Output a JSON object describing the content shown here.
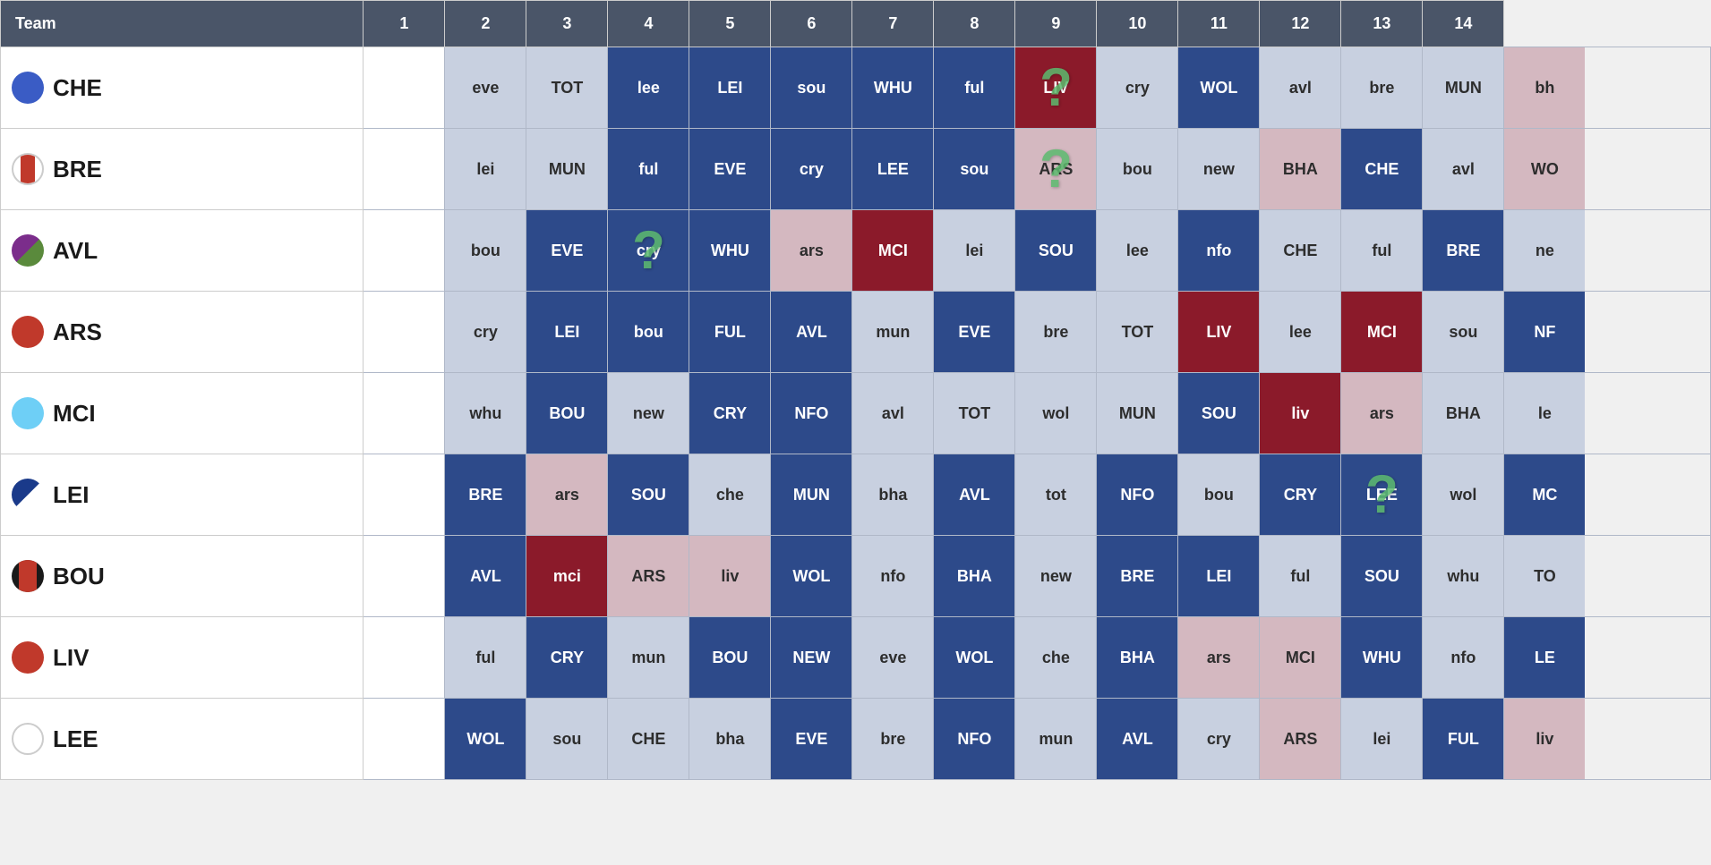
{
  "header": {
    "team_label": "Team",
    "columns": [
      "1",
      "2",
      "3",
      "4",
      "5",
      "6",
      "7",
      "8",
      "9",
      "10",
      "11",
      "12",
      "13",
      "14"
    ]
  },
  "teams": [
    {
      "id": "CHE",
      "name": "CHE",
      "badge": "badge-che",
      "fixtures": [
        {
          "text": "",
          "style": "empty-cell"
        },
        {
          "text": "eve",
          "style": "away-light"
        },
        {
          "text": "TOT",
          "style": "away-light"
        },
        {
          "text": "lee",
          "style": "home-dark"
        },
        {
          "text": "LEI",
          "style": "home-dark"
        },
        {
          "text": "sou",
          "style": "home-dark"
        },
        {
          "text": "WHU",
          "style": "home-dark"
        },
        {
          "text": "ful",
          "style": "home-dark"
        },
        {
          "text": "LIV",
          "style": "home-red",
          "question": true
        },
        {
          "text": "cry",
          "style": "away-light"
        },
        {
          "text": "WOL",
          "style": "home-dark"
        },
        {
          "text": "avl",
          "style": "away-light"
        },
        {
          "text": "bre",
          "style": "away-light"
        },
        {
          "text": "MUN",
          "style": "away-light"
        },
        {
          "text": "bh",
          "style": "away-pink"
        }
      ]
    },
    {
      "id": "BRE",
      "name": "BRE",
      "badge": "badge-bre",
      "fixtures": [
        {
          "text": "",
          "style": "empty-cell"
        },
        {
          "text": "lei",
          "style": "away-light"
        },
        {
          "text": "MUN",
          "style": "away-light"
        },
        {
          "text": "ful",
          "style": "home-dark"
        },
        {
          "text": "EVE",
          "style": "home-dark"
        },
        {
          "text": "cry",
          "style": "home-dark"
        },
        {
          "text": "LEE",
          "style": "home-dark"
        },
        {
          "text": "sou",
          "style": "home-dark"
        },
        {
          "text": "ARS",
          "style": "away-pink"
        },
        {
          "text": "bou",
          "style": "away-light",
          "question2": true
        },
        {
          "text": "new",
          "style": "away-light"
        },
        {
          "text": "BHA",
          "style": "away-pink"
        },
        {
          "text": "CHE",
          "style": "home-dark"
        },
        {
          "text": "avl",
          "style": "away-light"
        },
        {
          "text": "WO",
          "style": "away-pink"
        }
      ]
    },
    {
      "id": "AVL",
      "name": "AVL",
      "badge": "badge-avl",
      "fixtures": [
        {
          "text": "",
          "style": "empty-cell"
        },
        {
          "text": "bou",
          "style": "away-light"
        },
        {
          "text": "EVE",
          "style": "home-dark"
        },
        {
          "text": "cry",
          "style": "home-dark",
          "question3": true
        },
        {
          "text": "WHU",
          "style": "home-dark"
        },
        {
          "text": "ars",
          "style": "away-pink"
        },
        {
          "text": "MCI",
          "style": "home-red"
        },
        {
          "text": "lei",
          "style": "away-light"
        },
        {
          "text": "SOU",
          "style": "home-dark"
        },
        {
          "text": "lee",
          "style": "away-light"
        },
        {
          "text": "nfo",
          "style": "home-dark"
        },
        {
          "text": "CHE",
          "style": "away-light"
        },
        {
          "text": "ful",
          "style": "away-light"
        },
        {
          "text": "BRE",
          "style": "home-dark"
        },
        {
          "text": "ne",
          "style": "away-light"
        }
      ]
    },
    {
      "id": "ARS",
      "name": "ARS",
      "badge": "badge-ars",
      "fixtures": [
        {
          "text": "",
          "style": "empty-cell"
        },
        {
          "text": "cry",
          "style": "away-light"
        },
        {
          "text": "LEI",
          "style": "home-dark"
        },
        {
          "text": "bou",
          "style": "home-dark"
        },
        {
          "text": "FUL",
          "style": "home-dark"
        },
        {
          "text": "AVL",
          "style": "home-dark"
        },
        {
          "text": "mun",
          "style": "away-light"
        },
        {
          "text": "EVE",
          "style": "home-dark"
        },
        {
          "text": "bre",
          "style": "away-light"
        },
        {
          "text": "TOT",
          "style": "away-light"
        },
        {
          "text": "LIV",
          "style": "home-red"
        },
        {
          "text": "lee",
          "style": "away-light"
        },
        {
          "text": "MCI",
          "style": "home-red"
        },
        {
          "text": "sou",
          "style": "away-light"
        },
        {
          "text": "NF",
          "style": "home-dark"
        }
      ]
    },
    {
      "id": "MCI",
      "name": "MCI",
      "badge": "badge-mci",
      "fixtures": [
        {
          "text": "",
          "style": "empty-cell"
        },
        {
          "text": "whu",
          "style": "away-light"
        },
        {
          "text": "BOU",
          "style": "home-dark"
        },
        {
          "text": "new",
          "style": "away-light"
        },
        {
          "text": "CRY",
          "style": "home-dark"
        },
        {
          "text": "NFO",
          "style": "home-dark"
        },
        {
          "text": "avl",
          "style": "away-light"
        },
        {
          "text": "TOT",
          "style": "away-light"
        },
        {
          "text": "wol",
          "style": "away-light"
        },
        {
          "text": "MUN",
          "style": "away-light"
        },
        {
          "text": "SOU",
          "style": "home-dark"
        },
        {
          "text": "liv",
          "style": "home-red"
        },
        {
          "text": "ars",
          "style": "away-pink"
        },
        {
          "text": "BHA",
          "style": "away-light"
        },
        {
          "text": "le",
          "style": "away-light"
        }
      ]
    },
    {
      "id": "LEI",
      "name": "LEI",
      "badge": "badge-lei",
      "fixtures": [
        {
          "text": "",
          "style": "empty-cell"
        },
        {
          "text": "BRE",
          "style": "home-dark"
        },
        {
          "text": "ars",
          "style": "away-pink"
        },
        {
          "text": "SOU",
          "style": "home-dark"
        },
        {
          "text": "che",
          "style": "away-light"
        },
        {
          "text": "MUN",
          "style": "home-dark"
        },
        {
          "text": "bha",
          "style": "away-light"
        },
        {
          "text": "AVL",
          "style": "home-dark"
        },
        {
          "text": "tot",
          "style": "away-light"
        },
        {
          "text": "NFO",
          "style": "home-dark"
        },
        {
          "text": "bou",
          "style": "away-light"
        },
        {
          "text": "CRY",
          "style": "home-dark"
        },
        {
          "text": "LEE",
          "style": "home-dark",
          "question4": true
        },
        {
          "text": "wol",
          "style": "away-light"
        },
        {
          "text": "MC",
          "style": "home-dark"
        }
      ]
    },
    {
      "id": "BOU",
      "name": "BOU",
      "badge": "badge-bou",
      "fixtures": [
        {
          "text": "",
          "style": "empty-cell"
        },
        {
          "text": "AVL",
          "style": "home-dark"
        },
        {
          "text": "mci",
          "style": "home-red"
        },
        {
          "text": "ARS",
          "style": "away-pink"
        },
        {
          "text": "liv",
          "style": "away-pink"
        },
        {
          "text": "WOL",
          "style": "home-dark"
        },
        {
          "text": "nfo",
          "style": "away-light"
        },
        {
          "text": "BHA",
          "style": "home-dark"
        },
        {
          "text": "new",
          "style": "away-light"
        },
        {
          "text": "BRE",
          "style": "home-dark"
        },
        {
          "text": "LEI",
          "style": "home-dark"
        },
        {
          "text": "ful",
          "style": "away-light"
        },
        {
          "text": "SOU",
          "style": "home-dark"
        },
        {
          "text": "whu",
          "style": "away-light"
        },
        {
          "text": "TO",
          "style": "away-light"
        }
      ]
    },
    {
      "id": "LIV",
      "name": "LIV",
      "badge": "badge-liv",
      "fixtures": [
        {
          "text": "",
          "style": "empty-cell"
        },
        {
          "text": "ful",
          "style": "away-light"
        },
        {
          "text": "CRY",
          "style": "home-dark"
        },
        {
          "text": "mun",
          "style": "away-light"
        },
        {
          "text": "BOU",
          "style": "home-dark"
        },
        {
          "text": "NEW",
          "style": "home-dark"
        },
        {
          "text": "eve",
          "style": "away-light"
        },
        {
          "text": "WOL",
          "style": "home-dark"
        },
        {
          "text": "che",
          "style": "away-light"
        },
        {
          "text": "BHA",
          "style": "home-dark"
        },
        {
          "text": "ars",
          "style": "away-pink"
        },
        {
          "text": "MCI",
          "style": "away-pink"
        },
        {
          "text": "WHU",
          "style": "home-dark"
        },
        {
          "text": "nfo",
          "style": "away-light"
        },
        {
          "text": "LE",
          "style": "home-dark"
        }
      ]
    },
    {
      "id": "LEE",
      "name": "LEE",
      "badge": "badge-lee",
      "fixtures": [
        {
          "text": "",
          "style": "empty-cell"
        },
        {
          "text": "WOL",
          "style": "home-dark"
        },
        {
          "text": "sou",
          "style": "away-light"
        },
        {
          "text": "CHE",
          "style": "away-light"
        },
        {
          "text": "bha",
          "style": "away-light"
        },
        {
          "text": "EVE",
          "style": "home-dark"
        },
        {
          "text": "bre",
          "style": "away-light"
        },
        {
          "text": "NFO",
          "style": "home-dark"
        },
        {
          "text": "mun",
          "style": "away-light"
        },
        {
          "text": "AVL",
          "style": "home-dark"
        },
        {
          "text": "cry",
          "style": "away-light"
        },
        {
          "text": "ARS",
          "style": "away-pink"
        },
        {
          "text": "lei",
          "style": "away-light"
        },
        {
          "text": "FUL",
          "style": "home-dark"
        },
        {
          "text": "liv",
          "style": "away-pink"
        }
      ]
    }
  ],
  "question_marks": {
    "positions": [
      {
        "row": 0,
        "col": 8,
        "desc": "CHE row, col 9 (LIV fixture)"
      },
      {
        "row": 1,
        "col": 8,
        "desc": "BRE row, col 9 (bou fixture)"
      },
      {
        "row": 2,
        "col": 3,
        "desc": "AVL row, col 3 (cry fixture)"
      },
      {
        "row": 5,
        "col": 12,
        "desc": "LEI row, col 12 (LEE fixture)"
      }
    ]
  }
}
